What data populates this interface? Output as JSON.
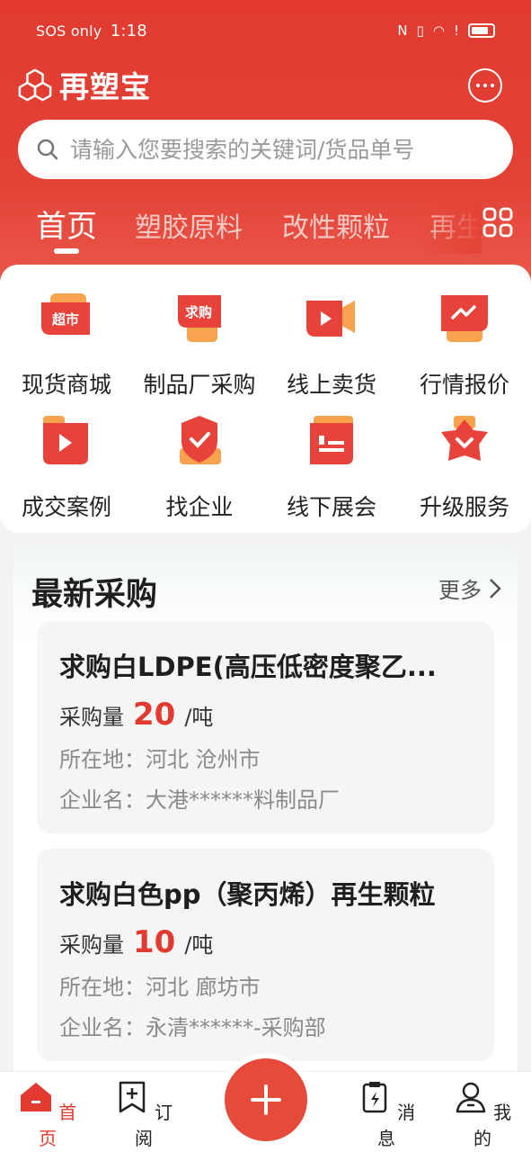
{
  "status_bar": {
    "carrier": "SOS only",
    "time": "1:18"
  },
  "app": {
    "name": "再塑宝"
  },
  "search": {
    "placeholder": "请输入您要搜索的关键词/货品单号"
  },
  "tabs": [
    {
      "label": "首页",
      "active": true
    },
    {
      "label": "塑胶原料",
      "active": false
    },
    {
      "label": "改性颗粒",
      "active": false
    },
    {
      "label": "再生",
      "active": false
    }
  ],
  "quick_menu": [
    {
      "label": "现货商城",
      "icon": "supermarket-icon",
      "badge": "超市"
    },
    {
      "label": "制品厂采购",
      "icon": "purchase-icon",
      "badge": "求购"
    },
    {
      "label": "线上卖货",
      "icon": "video-sell-icon"
    },
    {
      "label": "行情报价",
      "icon": "trend-icon"
    },
    {
      "label": "成交案例",
      "icon": "play-case-icon"
    },
    {
      "label": "找企业",
      "icon": "shield-check-icon"
    },
    {
      "label": "线下展会",
      "icon": "exhibition-icon"
    },
    {
      "label": "升级服务",
      "icon": "star-upgrade-icon"
    }
  ],
  "latest_purchase": {
    "title": "最新采购",
    "more_label": "更多",
    "items": [
      {
        "title": "求购白LDPE(高压低密度聚乙...",
        "qty_label": "采购量",
        "qty": "20",
        "unit": "/吨",
        "location": "所在地：河北 沧州市",
        "company": "企业名：大港******料制品厂"
      },
      {
        "title": "求购白色pp（聚丙烯）再生颗粒",
        "qty_label": "采购量",
        "qty": "10",
        "unit": "/吨",
        "location": "所在地：河北 廊坊市",
        "company": "企业名：永清******-采购部"
      }
    ]
  },
  "bottom_nav": [
    {
      "label": "首页",
      "icon": "home-icon",
      "active": true
    },
    {
      "label": "订阅",
      "icon": "subscribe-icon",
      "active": false
    },
    {
      "label": "消息",
      "icon": "message-icon",
      "active": false
    },
    {
      "label": "我的",
      "icon": "profile-icon",
      "active": false
    }
  ],
  "colors": {
    "brand_red": "#e23a30",
    "text_dark": "#1e1e1e",
    "text_gray": "#8a8a8a"
  }
}
